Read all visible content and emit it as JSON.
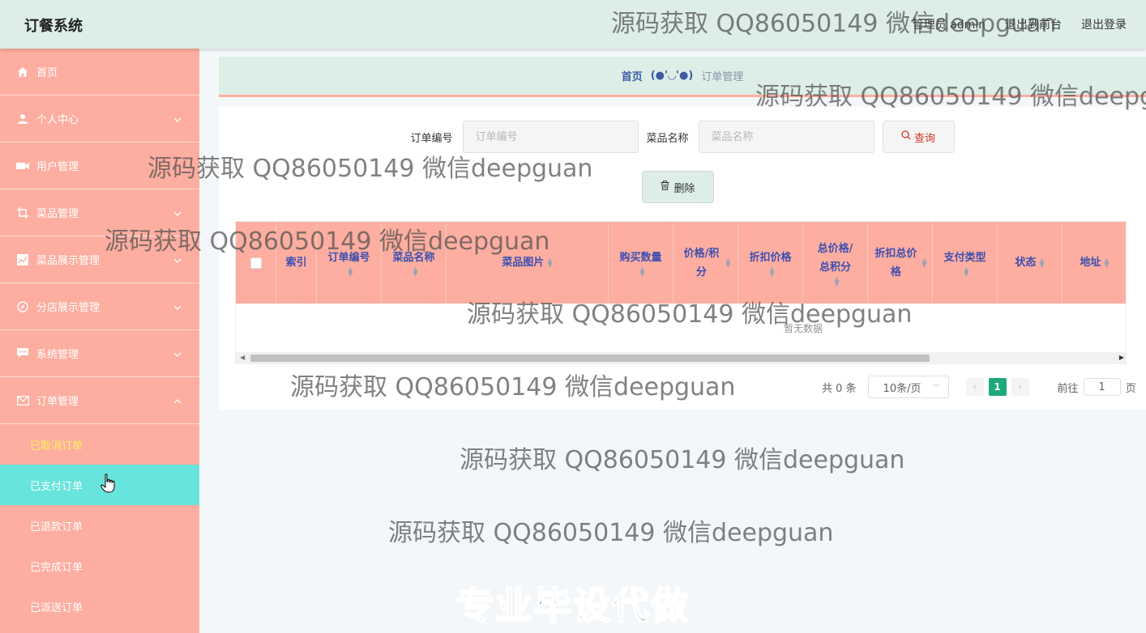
{
  "header": {
    "title": "订餐系统",
    "user": "管理员 admin",
    "to_frontend": "退出到前台",
    "logout": "退出登录"
  },
  "sidebar": {
    "items": [
      {
        "label": "首页",
        "icon": "home-icon"
      },
      {
        "label": "个人中心",
        "icon": "user-icon"
      },
      {
        "label": "用户管理",
        "icon": "video-icon"
      },
      {
        "label": "菜品管理",
        "icon": "crop-icon"
      },
      {
        "label": "菜品展示管理",
        "icon": "chart-icon"
      },
      {
        "label": "分店展示管理",
        "icon": "compass-icon"
      },
      {
        "label": "系统管理",
        "icon": "chat-icon"
      },
      {
        "label": "订单管理",
        "icon": "mail-icon"
      }
    ],
    "sub_items": [
      "已取消订单",
      "已支付订单",
      "已退款订单",
      "已完成订单",
      "已派送订单"
    ]
  },
  "breadcrumb": {
    "home": "首页",
    "separator": "(●'◡'●)",
    "current": "订单管理"
  },
  "search": {
    "order_no_label": "订单编号",
    "order_no_placeholder": "订单编号",
    "dish_name_label": "菜品名称",
    "dish_name_placeholder": "菜品名称",
    "query_label": "查询",
    "delete_label": "删除"
  },
  "table": {
    "columns": [
      "索引",
      "订单编号",
      "菜品名称",
      "菜品图片",
      "购买数量",
      "价格/积分",
      "折扣价格",
      "总价格/总积分",
      "折扣总价格",
      "支付类型",
      "状态",
      "地址"
    ],
    "empty_text": "暂无数据"
  },
  "pager": {
    "total": "共 0 条",
    "page_size": "10条/页",
    "current_page": "1",
    "goto_prefix": "前往",
    "goto_value": "1",
    "goto_suffix": "页"
  },
  "watermark": {
    "text": "源码获取 QQ86050149 微信deepguan",
    "promo": "专业毕设代做"
  },
  "colors": {
    "header_bg": "#dceee6",
    "sidebar_bg": "#fdaea0",
    "active_hover": "#67e4dc",
    "active_text": "#ffef5a",
    "table_header_text": "#3d4fb0",
    "page_active": "#1ea97c"
  }
}
